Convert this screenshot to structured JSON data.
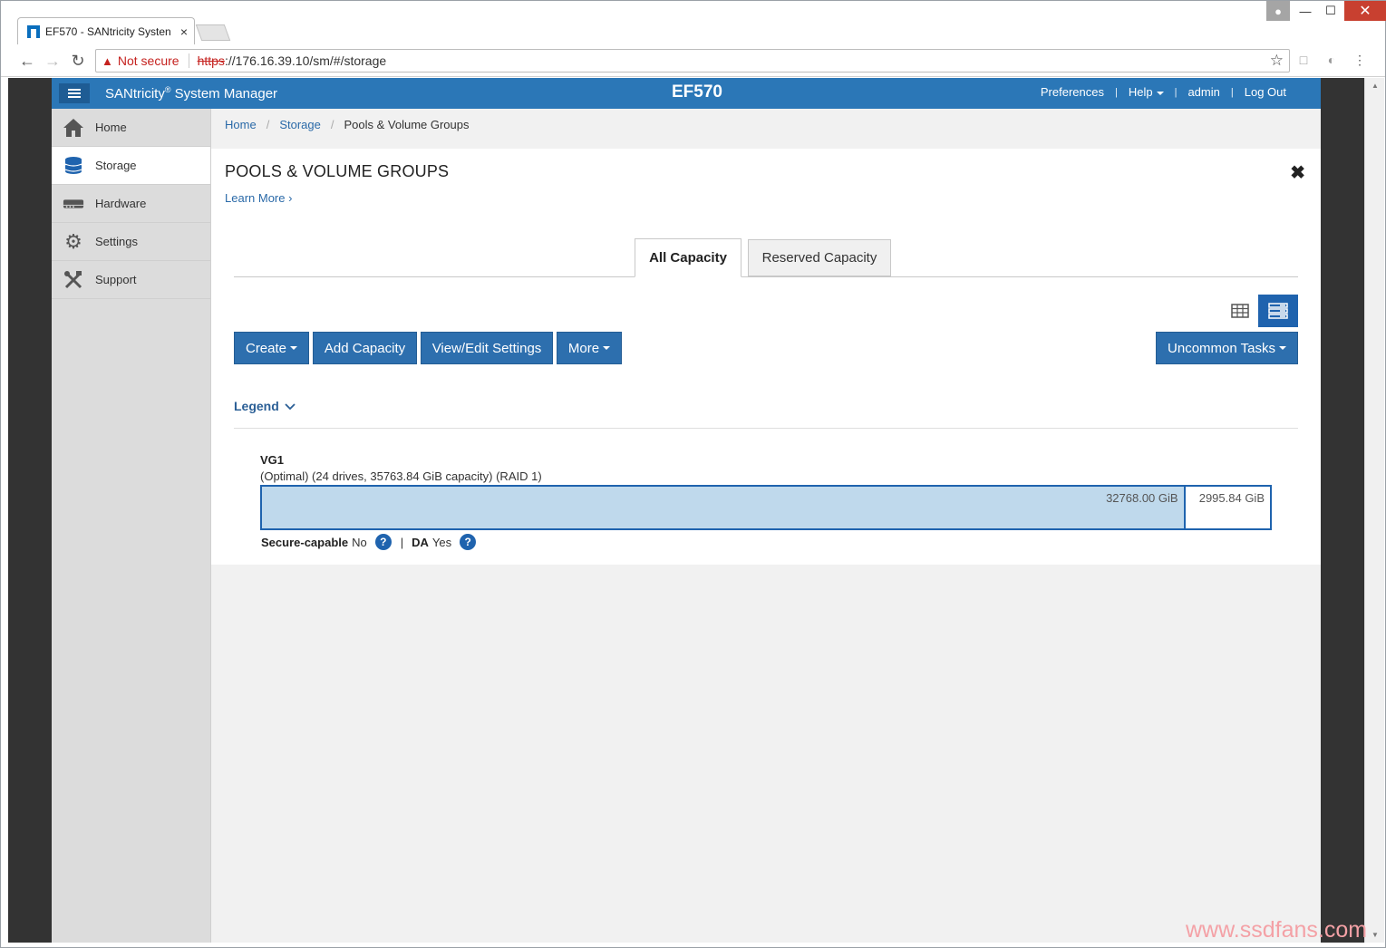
{
  "browser": {
    "tab_title": "EF570 - SANtricity Systen",
    "tab_close": "×",
    "security_label": "Not secure",
    "url_protocol": "https",
    "url_rest": "://176.16.39.10/sm/#/storage"
  },
  "header": {
    "brand_name": "SANtricity",
    "brand_reg": "®",
    "brand_suffix": " System Manager",
    "system_name": "EF570",
    "nav": {
      "preferences": "Preferences",
      "help": "Help",
      "user": "admin",
      "logout": "Log Out"
    }
  },
  "sidebar": {
    "items": [
      {
        "label": "Home",
        "icon": "home-icon"
      },
      {
        "label": "Storage",
        "icon": "storage-icon"
      },
      {
        "label": "Hardware",
        "icon": "hardware-icon"
      },
      {
        "label": "Settings",
        "icon": "gear-icon"
      },
      {
        "label": "Support",
        "icon": "tools-icon"
      }
    ],
    "active": "Storage"
  },
  "breadcrumb": [
    "Home",
    "Storage",
    "Pools & Volume Groups"
  ],
  "page": {
    "title": "POOLS & VOLUME GROUPS",
    "learn_more": "Learn More",
    "tabs": [
      "All Capacity",
      "Reserved Capacity"
    ],
    "active_tab": "All Capacity",
    "buttons": {
      "create": "Create",
      "add_capacity": "Add Capacity",
      "view_edit": "View/Edit Settings",
      "more": "More",
      "uncommon": "Uncommon Tasks"
    },
    "legend": "Legend"
  },
  "volume_group": {
    "name": "VG1",
    "description": "(Optimal) (24 drives, 35763.84 GiB capacity) (RAID 1)",
    "used_label": "32768.00 GiB",
    "free_label": "2995.84 GiB",
    "used_fraction": 0.916,
    "secure_label": "Secure-capable",
    "secure_value": "No",
    "da_label": "DA",
    "da_value": "Yes"
  },
  "colors": {
    "header_blue": "#2b77b7",
    "button_blue": "#2d6fae",
    "capacity_fill": "#bfd9ec",
    "capacity_border": "#1f63ae"
  },
  "watermark": "www.ssdfans.com"
}
